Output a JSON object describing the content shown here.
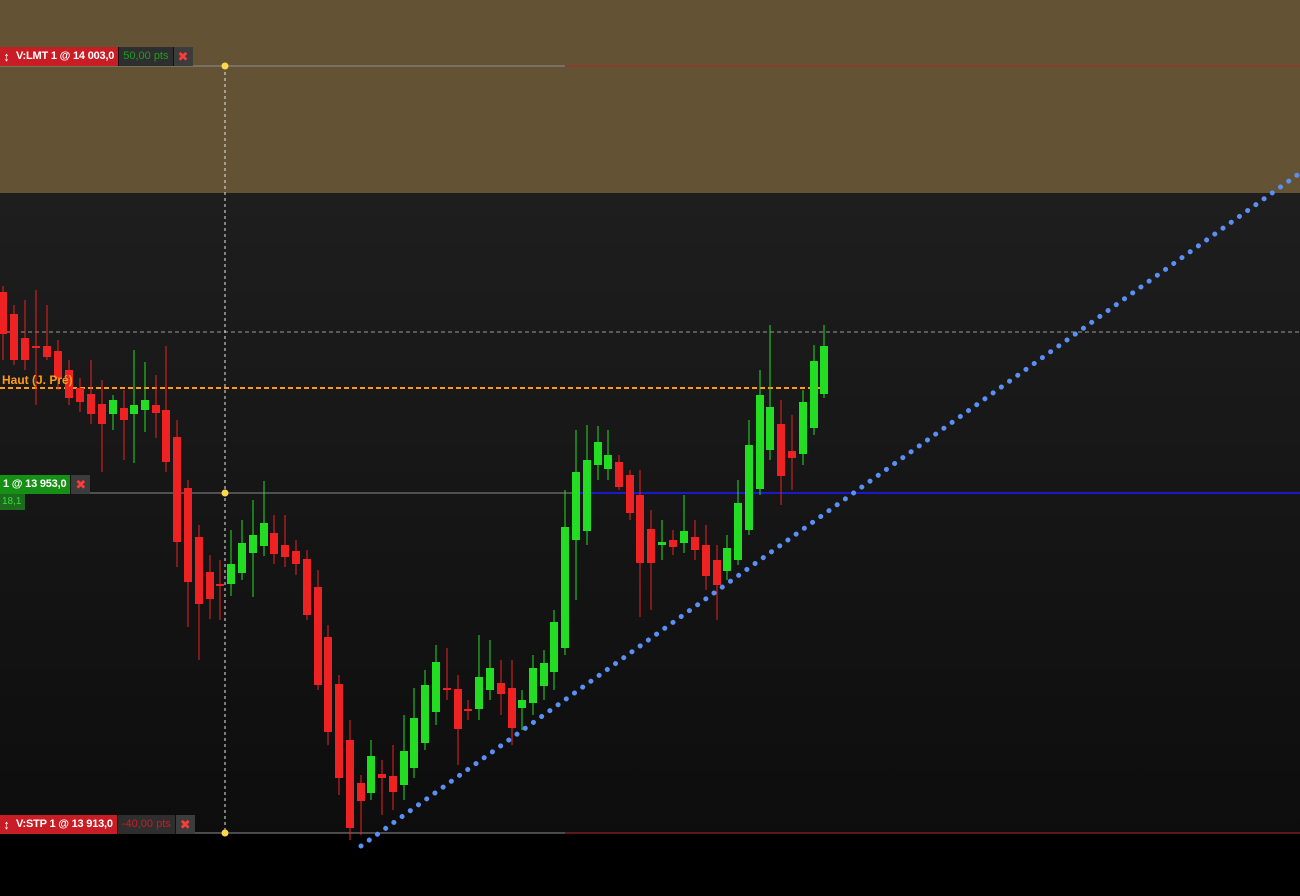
{
  "colors": {
    "profit_zone": "#635233",
    "background_top": "#1e1e1e",
    "background_bottom": "#0d0d0d",
    "bull_candle": "#22dd22",
    "bear_candle": "#ee2222",
    "level_line": "#ff9a1a",
    "position_line": "#1a1acc",
    "trend_line": "#5a8ff5"
  },
  "orders": {
    "limit": {
      "label": "V:LMT  1 @ 14 003,0",
      "points": "50,00 pts"
    },
    "stop": {
      "label": "V:STP  1 @ 13 913,0",
      "points": "-40,00 pts"
    }
  },
  "position": {
    "label": "1 @ 13 953,0",
    "pnl": "18,1"
  },
  "level": {
    "label": "Haut (J. Pré)"
  },
  "icons": {
    "grip": "resize-vertical-icon",
    "close": "close-x-icon"
  }
}
